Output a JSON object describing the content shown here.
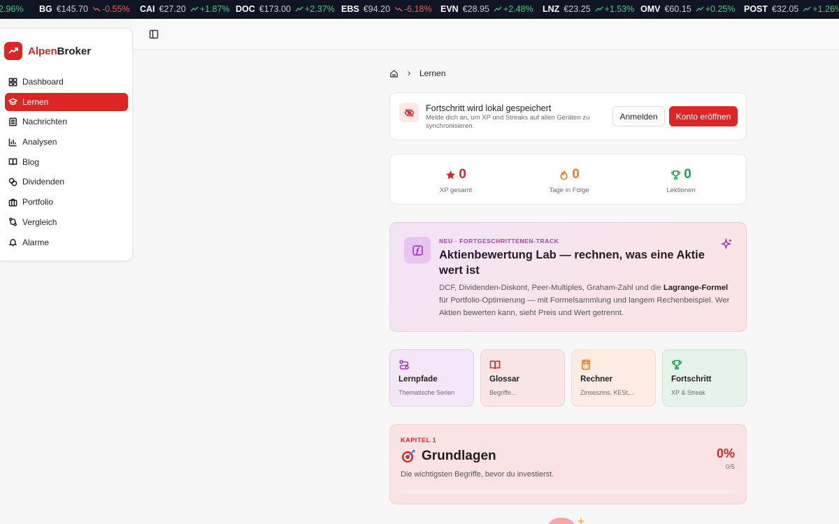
{
  "ticker": [
    {
      "symbol": "",
      "price": "",
      "change": "2.96%",
      "dir": "up"
    },
    {
      "symbol": "BG",
      "price": "€145.70",
      "change": "-0.55%",
      "dir": "down"
    },
    {
      "symbol": "CAI",
      "price": "€27.20",
      "change": "+1.87%",
      "dir": "up"
    },
    {
      "symbol": "DOC",
      "price": "€173.00",
      "change": "+2.37%",
      "dir": "up"
    },
    {
      "symbol": "EBS",
      "price": "€94.20",
      "change": "-6.18%",
      "dir": "down"
    },
    {
      "symbol": "EVN",
      "price": "€28.95",
      "change": "+2.48%",
      "dir": "up"
    },
    {
      "symbol": "LNZ",
      "price": "€23.25",
      "change": "+1.53%",
      "dir": "up"
    },
    {
      "symbol": "OMV",
      "price": "€60.15",
      "change": "+0.25%",
      "dir": "up"
    },
    {
      "symbol": "POST",
      "price": "€32.05",
      "change": "+1.26%",
      "dir": "up"
    }
  ],
  "brand": {
    "part1": "Alpen",
    "part2": "Broker"
  },
  "sidebar": {
    "items": [
      {
        "label": "Dashboard",
        "icon": "dashboard-icon",
        "active": false
      },
      {
        "label": "Lernen",
        "icon": "graduation-cap-icon",
        "active": true
      },
      {
        "label": "Nachrichten",
        "icon": "newspaper-icon",
        "active": false
      },
      {
        "label": "Analysen",
        "icon": "bar-chart-icon",
        "active": false
      },
      {
        "label": "Blog",
        "icon": "book-open-icon",
        "active": false
      },
      {
        "label": "Dividenden",
        "icon": "coins-icon",
        "active": false
      },
      {
        "label": "Portfolio",
        "icon": "briefcase-icon",
        "active": false
      },
      {
        "label": "Vergleich",
        "icon": "compare-icon",
        "active": false
      },
      {
        "label": "Alarme",
        "icon": "bell-icon",
        "active": false
      }
    ]
  },
  "breadcrumb": {
    "current": "Lernen"
  },
  "sync": {
    "title": "Fortschritt wird lokal gespeichert",
    "description": "Melde dich an, um XP und Streaks auf allen Geräten zu synchronisieren.",
    "login_label": "Anmelden",
    "open_account_label": "Konto eröffnen"
  },
  "stats": [
    {
      "value": "0",
      "label": "XP gesamt",
      "icon": "star-icon",
      "color": "#dc2626"
    },
    {
      "value": "0",
      "label": "Tage in Folge",
      "icon": "flame-icon",
      "color": "#ea7a1a"
    },
    {
      "value": "0",
      "label": "Lektionen",
      "icon": "trophy-icon",
      "color": "#16a34a"
    }
  ],
  "feature": {
    "tag": "NEU · FORTGESCHRITTENEN-TRACK",
    "title": "Aktienbewertung Lab — rechnen, was eine Aktie wert ist",
    "desc_before": "DCF, Dividenden-Diskont, Peer-Multiples, Graham-Zahl und die ",
    "desc_bold": "Lagrange-Formel",
    "desc_after": " für Portfolio-Optimierung — mit Formelsammlung und langem Rechenbeispiel. Wer Aktien bewerten kann, sieht Preis und Wert getrennt."
  },
  "quick_links": [
    {
      "title": "Lernpfade",
      "subtitle": "Thematische Serien",
      "icon": "route-icon",
      "color": "#a13bc6",
      "bg": "#f3e7f8",
      "border": "#e3cbe9"
    },
    {
      "title": "Glossar",
      "subtitle": "Begriffe...",
      "icon": "book-open-icon",
      "color": "#dc2626",
      "bg": "#fbe6e6",
      "border": "#f2cfcf"
    },
    {
      "title": "Rechner",
      "subtitle": "Zinseszins, KESt,...",
      "icon": "calculator-icon",
      "color": "#ea7a1a",
      "bg": "#fcece2",
      "border": "#f5d8c5"
    },
    {
      "title": "Fortschritt",
      "subtitle": "XP & Streak",
      "icon": "trophy-icon",
      "color": "#16a34a",
      "bg": "#e6f3ea",
      "border": "#cde6d4"
    }
  ],
  "chapter": {
    "tag": "KAPITEL 1",
    "title": "Grundlagen",
    "description": "Die wichtigsten Begriffe, bevor du investierst.",
    "percent": "0%",
    "count": "0/5",
    "progress": 0
  },
  "colors": {
    "accent": "#dc2626",
    "up": "#35d07f",
    "down": "#f25a5a"
  }
}
